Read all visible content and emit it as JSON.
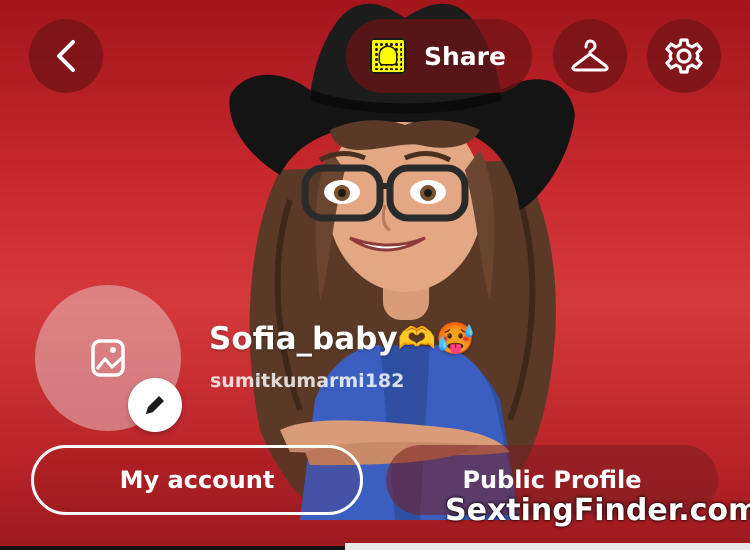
{
  "header": {
    "share_label": "Share",
    "back_icon": "chevron-left-icon",
    "snapcode_icon": "snapcode-icon",
    "hanger_icon": "hanger-icon",
    "settings_icon": "gear-icon"
  },
  "profile": {
    "display_name": "Sofia_baby🫶🥵",
    "username": "sumitkumarmi182",
    "photo_icon": "image-icon",
    "edit_icon": "pencil-icon"
  },
  "actions": {
    "my_account": "My account",
    "public_profile": "Public Profile"
  },
  "watermark": "SextingFinder.com",
  "colors": {
    "background": "#c92a2f",
    "button_fill": "#6e1416",
    "snapcode_yellow": "#fffc00",
    "text": "#ffffff"
  }
}
